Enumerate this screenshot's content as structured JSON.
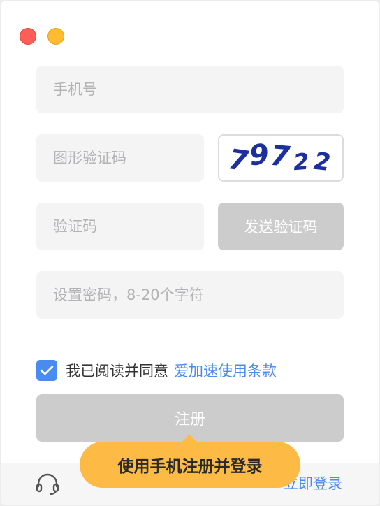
{
  "window": {
    "controls": [
      "close",
      "minimize"
    ]
  },
  "form": {
    "phone_placeholder": "手机号",
    "captcha_placeholder": "图形验证码",
    "captcha_image_text": {
      "c1": "7",
      "c2": "9",
      "c3": "7",
      "c4": "2",
      "c5": "2"
    },
    "sms_code_placeholder": "验证码",
    "send_code_label": "发送验证码",
    "password_placeholder": "设置密码，8-20个字符"
  },
  "agreement": {
    "checked": true,
    "text": "我已阅读并同意",
    "link": "爱加速使用条款"
  },
  "register_label": "注册",
  "tooltip_text": "使用手机注册并登录",
  "footer": {
    "support_icon": "headset-icon",
    "login_link_visible": "立即登录"
  },
  "colors": {
    "accent": "#4a8bf0",
    "disabled_button": "#cccccc",
    "tooltip": "#fdbb46",
    "close": "#fd5f57",
    "minimize": "#febc2e"
  }
}
